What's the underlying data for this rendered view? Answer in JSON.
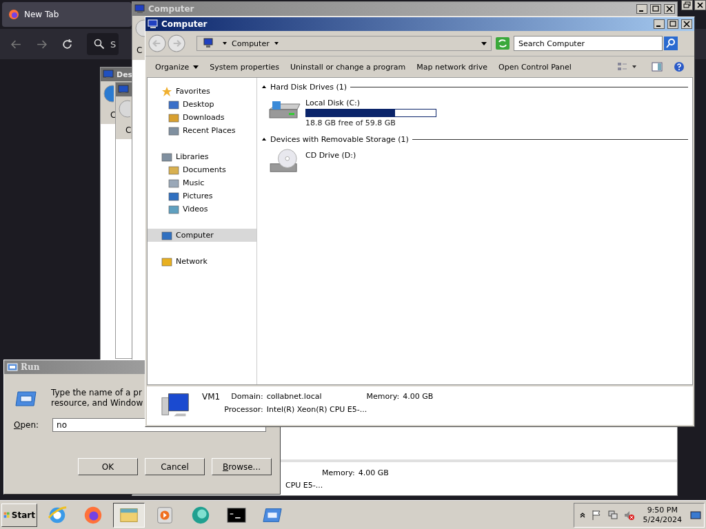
{
  "browser": {
    "tab_title": "New Tab",
    "search_placeholder": "S"
  },
  "background_windows": [
    {
      "title": "Des",
      "body_letter": "C"
    },
    {
      "body_letter": "C"
    }
  ],
  "back_explorer": {
    "title": "Computer",
    "body_letter": "C",
    "memory_label": "Memory:",
    "memory": "4.00 GB",
    "processor": "CPU E5-..."
  },
  "run_dialog": {
    "title": "Run",
    "description": [
      "Type the name of a pr",
      "resource, and Window"
    ],
    "open_label": "Open:",
    "value": "no",
    "buttons": [
      "OK",
      "Cancel",
      "Browse..."
    ]
  },
  "explorer": {
    "title": "Computer",
    "address": "Computer",
    "search_placeholder": "Search Computer",
    "commands": [
      {
        "label": "Organize",
        "dropdown": true
      },
      {
        "label": "System properties",
        "dropdown": false
      },
      {
        "label": "Uninstall or change a program",
        "dropdown": false
      },
      {
        "label": "Map network drive",
        "dropdown": false
      },
      {
        "label": "Open Control Panel",
        "dropdown": false
      }
    ],
    "nav": [
      {
        "label": "Favorites",
        "selected": false,
        "children": [
          {
            "label": "Desktop",
            "selected": false
          },
          {
            "label": "Downloads",
            "selected": false
          },
          {
            "label": "Recent Places",
            "selected": false
          }
        ]
      },
      {
        "label": "Libraries",
        "selected": false,
        "children": [
          {
            "label": "Documents",
            "selected": false
          },
          {
            "label": "Music",
            "selected": false
          },
          {
            "label": "Pictures",
            "selected": false
          },
          {
            "label": "Videos",
            "selected": false
          }
        ]
      },
      {
        "label": "Computer",
        "selected": true
      },
      {
        "label": "Network",
        "selected": false
      }
    ],
    "groups": [
      {
        "title": "Hard Disk Drives (1)",
        "items": [
          {
            "kind": "disk",
            "name": "Local Disk (C:)",
            "level": 0.686,
            "free": "18.8 GB free of 59.8 GB"
          }
        ]
      },
      {
        "title": "Devices with Removable Storage (1)",
        "items": [
          {
            "kind": "cd",
            "name": "CD Drive (D:)"
          }
        ]
      }
    ],
    "details": {
      "name": "VM1",
      "domain_label": "Domain:",
      "domain": "collabnet.local",
      "memory_label": "Memory:",
      "memory": "4.00 GB",
      "processor_label": "Processor:",
      "processor": "Intel(R) Xeon(R) CPU E5-..."
    }
  },
  "taskbar": {
    "start": "Start",
    "items": [
      {
        "selected": false
      },
      {
        "selected": false
      },
      {
        "selected": true
      },
      {
        "selected": false
      },
      {
        "selected": false
      },
      {
        "selected": false
      },
      {
        "selected": false
      }
    ],
    "time": "9:50 PM",
    "date": "5/24/2024"
  }
}
